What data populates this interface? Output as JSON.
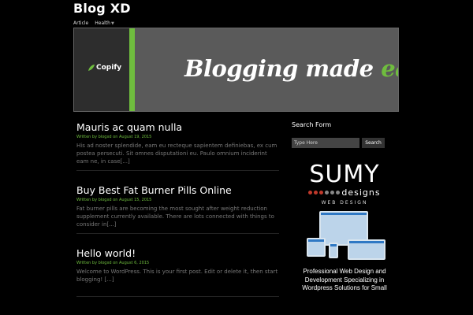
{
  "site": {
    "title": "Blog XD"
  },
  "nav": {
    "items": [
      "Article",
      "Health"
    ]
  },
  "banner": {
    "logo_text": "Copify",
    "tagline_start": "Blogging made ",
    "tagline_highlight": "easy"
  },
  "posts": [
    {
      "title": "Mauris ac quam nulla",
      "meta_prefix": "Written by ",
      "author": "blogxd",
      "meta_on": " on ",
      "date": "August 19, 2015",
      "excerpt": "His ad noster splendide, eam eu recteque sapientem definiebas, ex cum postea persecuti. Sit omnes disputationi eu. Paulo omnium inciderint eam ne, in case[...]"
    },
    {
      "title": "Buy Best Fat Burner Pills Online",
      "meta_prefix": "Written by ",
      "author": "blogxd",
      "meta_on": " on ",
      "date": "August 15, 2015",
      "excerpt": "Fat burner pills are becoming the most sought after weight reduction supplement currently available. There are lots connected with things to consider in[...]"
    },
    {
      "title": "Hello world!",
      "meta_prefix": "Written by ",
      "author": "blogxd",
      "meta_on": " on ",
      "date": "August 6, 2015",
      "excerpt": "Welcome to WordPress. This is your first post. Edit or delete it, then start blogging! [...]"
    }
  ],
  "sidebar": {
    "search_title": "Search Form",
    "search_placeholder": "Type Here",
    "search_button": "Search",
    "ad": {
      "brand": "SUMY",
      "designs": "designs",
      "web_design": "WEB DESIGN",
      "desc": "Professional Web Design and Development Specializing in Wordpress Solutions for Small",
      "dot_colors": [
        "#c0392b",
        "#c0392b",
        "#c0392b",
        "#888888",
        "#888888",
        "#888888"
      ]
    }
  },
  "colors": {
    "accent": "#6fbd3e",
    "background": "#000000"
  }
}
